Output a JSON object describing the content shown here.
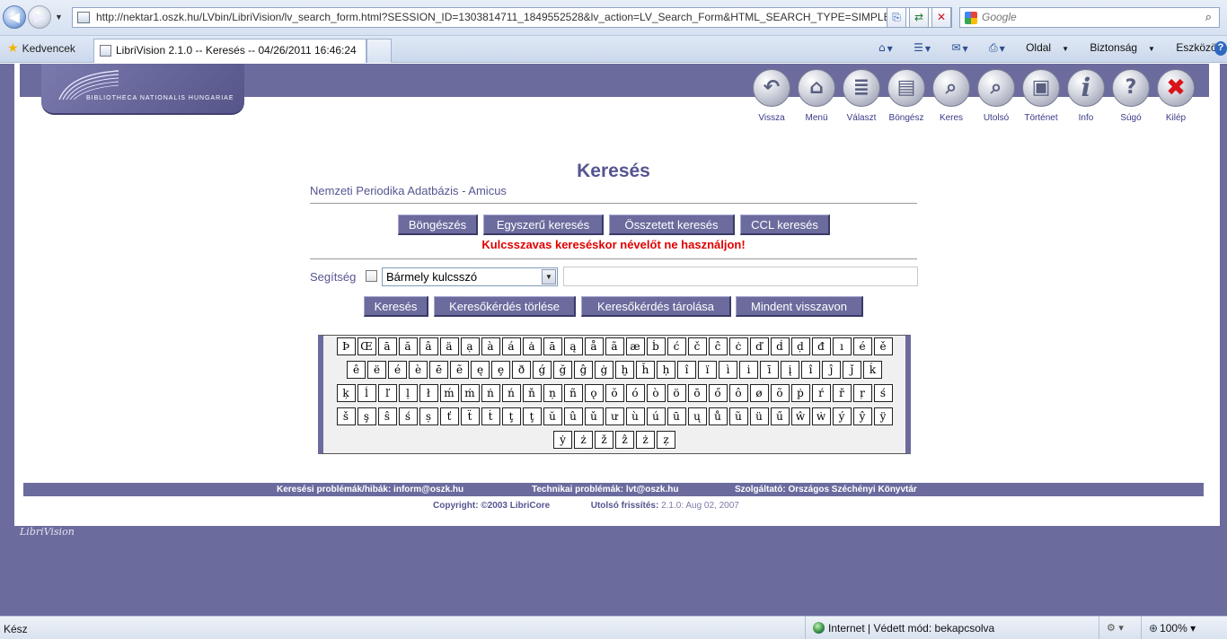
{
  "browser": {
    "url": "http://nektar1.oszk.hu/LVbin/LibriVision/lv_search_form.html?SESSION_ID=1303814711_1849552528&lv_action=LV_Search_Form&HTML_SEARCH_TYPE=SIMPLE&I",
    "search_placeholder": "Google",
    "favorites_label": "Kedvencek",
    "tab_title": "LibriVision 2.1.0 -- Keresés -- 04/26/2011 16:46:24",
    "commands": {
      "page": "Oldal",
      "safety": "Biztonság",
      "tools": "Eszközök"
    },
    "status": "Kész",
    "zone": "Internet | Védett mód: bekapcsolva",
    "zoom": "100%"
  },
  "header": {
    "logo_text": "BIBLIOTHECA NATIONALIS HUNGARIAE",
    "toolbar": [
      {
        "label": "Vissza",
        "icon": "back-arrow-icon",
        "glyph": "↶"
      },
      {
        "label": "Menü",
        "icon": "house-icon",
        "glyph": "⌂"
      },
      {
        "label": "Választ",
        "icon": "database-stack-icon",
        "glyph": "≣"
      },
      {
        "label": "Böngész",
        "icon": "card-index-icon",
        "glyph": "▤"
      },
      {
        "label": "Keres",
        "icon": "magnifier-icon",
        "glyph": "⌕"
      },
      {
        "label": "Utolsó",
        "icon": "magnifier-arrow-icon",
        "glyph": "⌕"
      },
      {
        "label": "Történet",
        "icon": "history-window-icon",
        "glyph": "▣"
      },
      {
        "label": "Info",
        "icon": "info-icon",
        "glyph": "i"
      },
      {
        "label": "Súgó",
        "icon": "help-question-icon",
        "glyph": "?"
      },
      {
        "label": "Kilép",
        "icon": "exit-x-icon",
        "glyph": "✖"
      }
    ]
  },
  "main": {
    "title": "Keresés",
    "database": "Nemzeti Periodika Adatbázis - Amicus",
    "tabs": [
      "Böngészés",
      "Egyszerű keresés",
      "Összetett keresés",
      "CCL keresés"
    ],
    "warning": "Kulcsszavas kereséskor névelőt ne használjon!",
    "help_label": "Segítség",
    "field_selected": "Bármely kulcsszó",
    "query_value": "",
    "buttons": [
      "Keresés",
      "Keresőkérdés törlése",
      "Keresőkérdés tárolása",
      "Mindent visszavon"
    ]
  },
  "special_chars": [
    [
      "Þ",
      "Œ",
      "ā",
      "ă",
      "â",
      "ä",
      "ạ",
      "à",
      "á",
      "ȧ",
      "ā",
      "ą",
      "å",
      "ã",
      "æ",
      "ḃ",
      "ć",
      "č",
      "ĉ",
      "ċ",
      "ď",
      "ḋ",
      "ḍ",
      "đ",
      "ı",
      "é",
      "ě"
    ],
    [
      "ê",
      "ë",
      "é",
      "è",
      "ē",
      "ẽ",
      "ę",
      "ȩ",
      "ð",
      "ǵ",
      "ğ",
      "ĝ",
      "ġ",
      "ḫ",
      "ȟ",
      "ḥ",
      "î",
      "ï",
      "ì",
      "i",
      "ī",
      "į",
      "î",
      "ĵ",
      "ǰ",
      "ḱ"
    ],
    [
      "ķ",
      "ĺ",
      "ľ",
      "ḷ",
      "ł",
      "ḿ",
      "ṁ",
      "ṅ",
      "ń",
      "ň",
      "ṇ",
      "ñ",
      "ǫ",
      "ŏ",
      "ó",
      "ò",
      "ö",
      "ō",
      "ő",
      "ô",
      "ø",
      "õ",
      "ṗ",
      "ŕ",
      "ř",
      "ŗ",
      "ś"
    ],
    [
      "š",
      "ş",
      "ŝ",
      "ś",
      "ṣ",
      "ť",
      "ẗ",
      "ṫ",
      "ţ",
      "ţ",
      "ŭ",
      "û",
      "ǔ",
      "ư",
      "ù",
      "ú",
      "ū",
      "ų",
      "ů",
      "ũ",
      "ü",
      "ű",
      "ŵ",
      "ẇ",
      "ý",
      "ŷ",
      "ÿ"
    ],
    [
      "ẏ",
      "ż",
      "ž",
      "ẑ",
      "ż",
      "ẓ"
    ]
  ],
  "footer": {
    "search_issues": "Keresési problémák/hibák: inform@oszk.hu",
    "tech_issues": "Technikai problémák: lvt@oszk.hu",
    "provider": "Szolgáltató: Országos Széchényi Könyvtár",
    "copyright": "Copyright: ©2003 LibriCore",
    "last_update_label": "Utolsó frissítés:",
    "last_update_value": "2.1.0: Aug 02, 2007",
    "brand": "LibriVision"
  },
  "colors": {
    "accent": "#6b6b9e",
    "warning": "#e10000",
    "title": "#555591"
  }
}
